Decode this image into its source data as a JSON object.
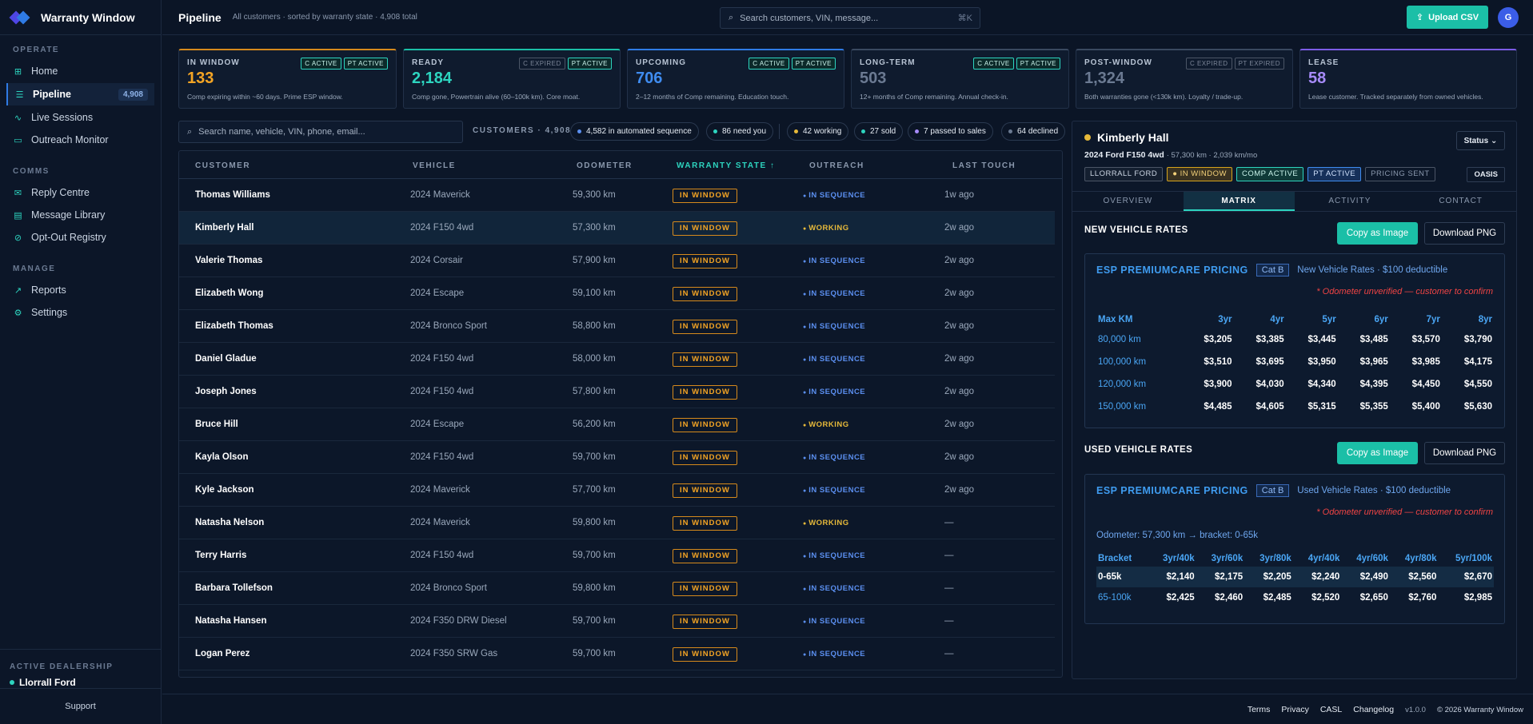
{
  "brand": {
    "name": "Warranty Window"
  },
  "sidebar": {
    "sections": [
      {
        "title": "OPERATE",
        "items": [
          {
            "label": "Home",
            "icon": "grid-icon",
            "glyph": "⊞"
          },
          {
            "label": "Pipeline",
            "icon": "list-icon",
            "glyph": "☰",
            "badge": "4,908",
            "active": true
          },
          {
            "label": "Live Sessions",
            "icon": "activity-icon",
            "glyph": "∿"
          },
          {
            "label": "Outreach Monitor",
            "icon": "monitor-icon",
            "glyph": "▭"
          }
        ]
      },
      {
        "title": "COMMS",
        "items": [
          {
            "label": "Reply Centre",
            "icon": "mail-icon",
            "glyph": "✉"
          },
          {
            "label": "Message Library",
            "icon": "archive-icon",
            "glyph": "▤"
          },
          {
            "label": "Opt-Out Registry",
            "icon": "block-icon",
            "glyph": "⊘"
          }
        ]
      },
      {
        "title": "MANAGE",
        "items": [
          {
            "label": "Reports",
            "icon": "trend-icon",
            "glyph": "↗"
          },
          {
            "label": "Settings",
            "icon": "gear-icon",
            "glyph": "⚙"
          }
        ]
      }
    ],
    "dealership_label": "ACTIVE DEALERSHIP",
    "dealership_name": "Llorrall Ford",
    "support": "Support"
  },
  "header": {
    "title": "Pipeline",
    "subtitle": "All customers · sorted by warranty state · 4,908 total",
    "search_placeholder": "Search customers, VIN, message...",
    "search_shortcut": "⌘K",
    "upload_label": "Upload CSV",
    "avatar": "G"
  },
  "stats": [
    {
      "label": "IN WINDOW",
      "value": "133",
      "desc": "Comp expiring within ~60 days. Prime ESP window.",
      "chips": [
        {
          "t": "C ACTIVE",
          "on": true
        },
        {
          "t": "PT ACTIVE",
          "on": true
        }
      ],
      "color": "#f5a524",
      "border": "#d68a1c"
    },
    {
      "label": "READY",
      "value": "2,184",
      "desc": "Comp gone, Powertrain alive (60–100k km). Core moat.",
      "chips": [
        {
          "t": "C EXPIRED",
          "on": false
        },
        {
          "t": "PT ACTIVE",
          "on": true
        }
      ],
      "color": "#2dd4bf",
      "border": "#1bbfa7"
    },
    {
      "label": "UPCOMING",
      "value": "706",
      "desc": "2–12 months of Comp remaining. Education touch.",
      "chips": [
        {
          "t": "C ACTIVE",
          "on": true
        },
        {
          "t": "PT ACTIVE",
          "on": true
        }
      ],
      "color": "#3f8cf0",
      "border": "#2f7be5"
    },
    {
      "label": "LONG-TERM",
      "value": "503",
      "desc": "12+ months of Comp remaining. Annual check-in.",
      "chips": [
        {
          "t": "C ACTIVE",
          "on": true
        },
        {
          "t": "PT ACTIVE",
          "on": true
        }
      ],
      "color": "#6b7a92",
      "border": "#3a4960"
    },
    {
      "label": "POST-WINDOW",
      "value": "1,324",
      "desc": "Both warranties gone (<130k km). Loyalty / trade-up.",
      "chips": [
        {
          "t": "C EXPIRED",
          "on": false
        },
        {
          "t": "PT EXPIRED",
          "on": false
        }
      ],
      "color": "#6b7a92",
      "border": "#3a4960"
    },
    {
      "label": "LEASE",
      "value": "58",
      "desc": "Lease customer. Tracked separately from owned vehicles.",
      "chips": [],
      "color": "#a78bfa",
      "border": "#7c5ce6"
    }
  ],
  "filter": {
    "search_placeholder": "Search name, vehicle, VIN, phone, email...",
    "customers_count": "CUSTOMERS · 4,908",
    "pills": [
      {
        "label": "4,582 in automated sequence",
        "color": "#5b8ff0"
      },
      {
        "label": "86 need you",
        "color": "#2dd4bf"
      },
      {
        "label": "42 working",
        "color": "#e6b93a"
      },
      {
        "label": "27 sold",
        "color": "#2dd4bf"
      },
      {
        "label": "7 passed to sales",
        "color": "#a78bfa"
      },
      {
        "label": "64 declined",
        "color": "#6b7a92"
      }
    ]
  },
  "table": {
    "headers": [
      "CUSTOMER",
      "VEHICLE",
      "ODOMETER",
      "WARRANTY STATE ↑",
      "OUTREACH",
      "LAST TOUCH"
    ],
    "rows": [
      {
        "name": "Thomas Williams",
        "vehicle": "2024 Maverick",
        "odo": "59,300 km",
        "state": "IN WINDOW",
        "outreach": "IN SEQUENCE",
        "touch": "1w ago"
      },
      {
        "name": "Kimberly Hall",
        "vehicle": "2024 F150 4wd",
        "odo": "57,300 km",
        "state": "IN WINDOW",
        "outreach": "WORKING",
        "touch": "2w ago",
        "sel": true
      },
      {
        "name": "Valerie Thomas",
        "vehicle": "2024 Corsair",
        "odo": "57,900 km",
        "state": "IN WINDOW",
        "outreach": "IN SEQUENCE",
        "touch": "2w ago"
      },
      {
        "name": "Elizabeth Wong",
        "vehicle": "2024 Escape",
        "odo": "59,100 km",
        "state": "IN WINDOW",
        "outreach": "IN SEQUENCE",
        "touch": "2w ago"
      },
      {
        "name": "Elizabeth Thomas",
        "vehicle": "2024 Bronco Sport",
        "odo": "58,800 km",
        "state": "IN WINDOW",
        "outreach": "IN SEQUENCE",
        "touch": "2w ago"
      },
      {
        "name": "Daniel Gladue",
        "vehicle": "2024 F150 4wd",
        "odo": "58,000 km",
        "state": "IN WINDOW",
        "outreach": "IN SEQUENCE",
        "touch": "2w ago"
      },
      {
        "name": "Joseph Jones",
        "vehicle": "2024 F150 4wd",
        "odo": "57,800 km",
        "state": "IN WINDOW",
        "outreach": "IN SEQUENCE",
        "touch": "2w ago"
      },
      {
        "name": "Bruce Hill",
        "vehicle": "2024 Escape",
        "odo": "56,200 km",
        "state": "IN WINDOW",
        "outreach": "WORKING",
        "touch": "2w ago"
      },
      {
        "name": "Kayla Olson",
        "vehicle": "2024 F150 4wd",
        "odo": "59,700 km",
        "state": "IN WINDOW",
        "outreach": "IN SEQUENCE",
        "touch": "2w ago"
      },
      {
        "name": "Kyle Jackson",
        "vehicle": "2024 Maverick",
        "odo": "57,700 km",
        "state": "IN WINDOW",
        "outreach": "IN SEQUENCE",
        "touch": "2w ago"
      },
      {
        "name": "Natasha Nelson",
        "vehicle": "2024 Maverick",
        "odo": "59,800 km",
        "state": "IN WINDOW",
        "outreach": "WORKING",
        "touch": "—"
      },
      {
        "name": "Terry Harris",
        "vehicle": "2024 F150 4wd",
        "odo": "59,700 km",
        "state": "IN WINDOW",
        "outreach": "IN SEQUENCE",
        "touch": "—"
      },
      {
        "name": "Barbara Tollefson",
        "vehicle": "2024 Bronco Sport",
        "odo": "59,800 km",
        "state": "IN WINDOW",
        "outreach": "IN SEQUENCE",
        "touch": "—"
      },
      {
        "name": "Natasha Hansen",
        "vehicle": "2024 F350 DRW Diesel",
        "odo": "59,700 km",
        "state": "IN WINDOW",
        "outreach": "IN SEQUENCE",
        "touch": "—"
      },
      {
        "name": "Logan Perez",
        "vehicle": "2024 F350 SRW Gas",
        "odo": "59,700 km",
        "state": "IN WINDOW",
        "outreach": "IN SEQUENCE",
        "touch": "—"
      }
    ]
  },
  "detail": {
    "name": "Kimberly Hall",
    "vehicle": "2024 Ford F150 4wd",
    "meta": "· 57,300 km · 2,039 km/mo",
    "status_label": "Status ⌄",
    "tags": [
      {
        "t": "LLORRALL FORD",
        "bc": "#4b5566",
        "c": "#cbd5e3",
        "bg": "#141f30"
      },
      {
        "t": "● IN WINDOW",
        "bc": "#d6a41c",
        "c": "#f5d27a",
        "bg": "#3a3220"
      },
      {
        "t": "COMP ACTIVE",
        "bc": "#2dd4bf",
        "c": "#c9f3ea",
        "bg": "#0f3a38"
      },
      {
        "t": "PT ACTIVE",
        "bc": "#3f8cf0",
        "c": "#cfe0fb",
        "bg": "#16305a"
      },
      {
        "t": "PRICING SENT",
        "bc": "#4b5566",
        "c": "#8a98ad",
        "bg": "transparent"
      }
    ],
    "oasis": "OASIS",
    "tabs": [
      "OVERVIEW",
      "MATRIX",
      "ACTIVITY",
      "CONTACT"
    ],
    "active_tab": 1,
    "copy_label": "Copy as Image",
    "png_label": "Download PNG",
    "new": {
      "section": "NEW VEHICLE RATES",
      "title": "ESP PREMIUMCARE PRICING",
      "cat": "Cat B",
      "sub": "New Vehicle Rates · $100 deductible",
      "warn": "* Odometer unverified — customer to confirm",
      "headers": [
        "Max KM",
        "3yr",
        "4yr",
        "5yr",
        "6yr",
        "7yr",
        "8yr"
      ],
      "rows": [
        [
          "80,000 km",
          "$3,205",
          "$3,385",
          "$3,445",
          "$3,485",
          "$3,570",
          "$3,790"
        ],
        [
          "100,000 km",
          "$3,510",
          "$3,695",
          "$3,950",
          "$3,965",
          "$3,985",
          "$4,175"
        ],
        [
          "120,000 km",
          "$3,900",
          "$4,030",
          "$4,340",
          "$4,395",
          "$4,450",
          "$4,550"
        ],
        [
          "150,000 km",
          "$4,485",
          "$4,605",
          "$5,315",
          "$5,355",
          "$5,400",
          "$5,630"
        ]
      ]
    },
    "used": {
      "section": "USED VEHICLE RATES",
      "title": "ESP PREMIUMCARE PRICING",
      "cat": "Cat B",
      "sub": "Used Vehicle Rates · $100 deductible",
      "warn": "* Odometer unverified — customer to confirm",
      "odo_line": "Odometer: 57,300 km → bracket: 0-65k",
      "headers": [
        "Bracket",
        "3yr/40k",
        "3yr/60k",
        "3yr/80k",
        "4yr/40k",
        "4yr/60k",
        "4yr/80k",
        "5yr/100k"
      ],
      "rows": [
        [
          "0-65k",
          "$2,140",
          "$2,175",
          "$2,205",
          "$2,240",
          "$2,490",
          "$2,560",
          "$2,670"
        ],
        [
          "65-100k",
          "$2,425",
          "$2,460",
          "$2,485",
          "$2,520",
          "$2,650",
          "$2,760",
          "$2,985"
        ]
      ],
      "highlight_row": 0
    }
  },
  "footer": {
    "links": [
      "Terms",
      "Privacy",
      "CASL",
      "Changelog"
    ],
    "version": "v1.0.0",
    "copyright": "© 2026 Warranty Window"
  }
}
